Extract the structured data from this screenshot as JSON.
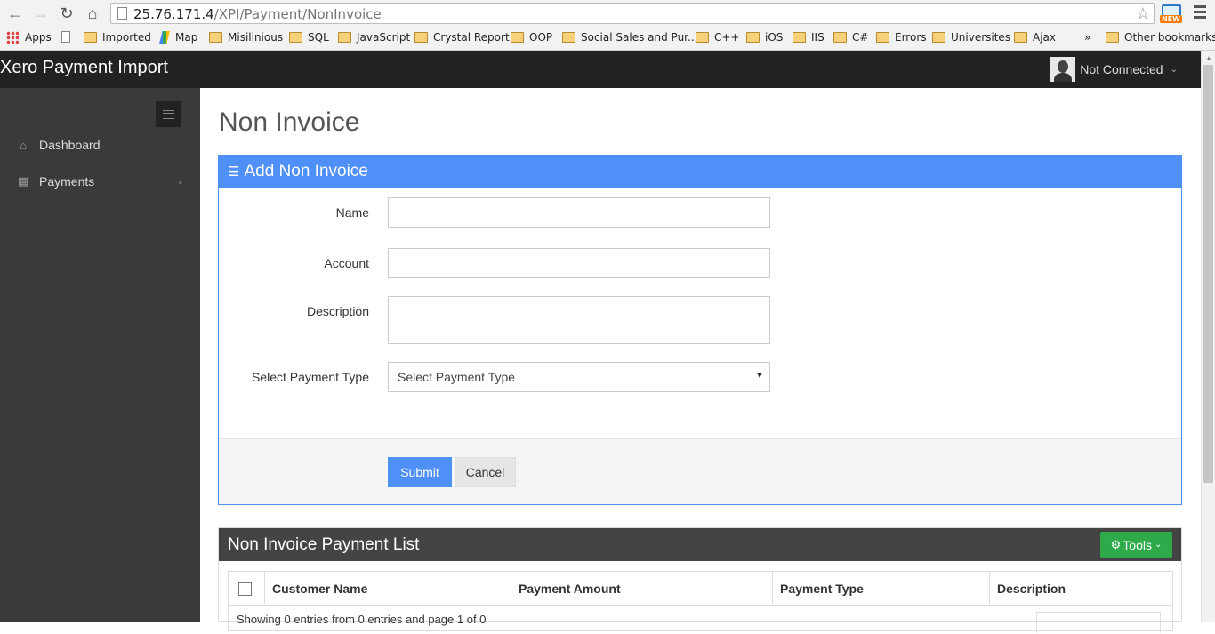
{
  "browser": {
    "url_host": "25.76.171.4",
    "url_path": "/XPI/Payment/NonInvoice",
    "new_badge": "NEW",
    "bookmarks": [
      "Apps",
      "",
      "Imported",
      "Map",
      "Misilinious",
      "SQL",
      "JavaScript",
      "Crystal Report",
      "OOP",
      "Social Sales and Pur...",
      "C++",
      "iOS",
      "IIS",
      "C#",
      "Errors",
      "Universites",
      "Ajax"
    ],
    "more": "»",
    "other_bookmarks": "Other bookmarks"
  },
  "header": {
    "brand": "Xero Payment Import",
    "user_status": "Not Connected"
  },
  "sidebar": {
    "items": [
      {
        "label": "Dashboard",
        "icon": "home-icon"
      },
      {
        "label": "Payments",
        "icon": "table-icon"
      }
    ]
  },
  "main": {
    "page_title": "Non Invoice",
    "form": {
      "heading": "Add Non Invoice",
      "name_label": "Name",
      "name_value": "",
      "account_label": "Account",
      "account_value": "",
      "description_label": "Description",
      "description_value": "",
      "payment_type_label": "Select Payment Type",
      "payment_type_selected": "Select Payment Type",
      "submit_label": "Submit",
      "cancel_label": "Cancel"
    },
    "list": {
      "heading": "Non Invoice Payment List",
      "tools_label": "Tools",
      "columns": [
        "Customer Name",
        "Payment Amount",
        "Payment Type",
        "Description"
      ],
      "info": "Showing 0 entries from 0 entries and page 1 of 0"
    }
  },
  "colors": {
    "primary": "#4e8ff8",
    "success": "#2faa4a",
    "header_bg": "#222222",
    "sidebar_bg": "#3a3a3a"
  }
}
